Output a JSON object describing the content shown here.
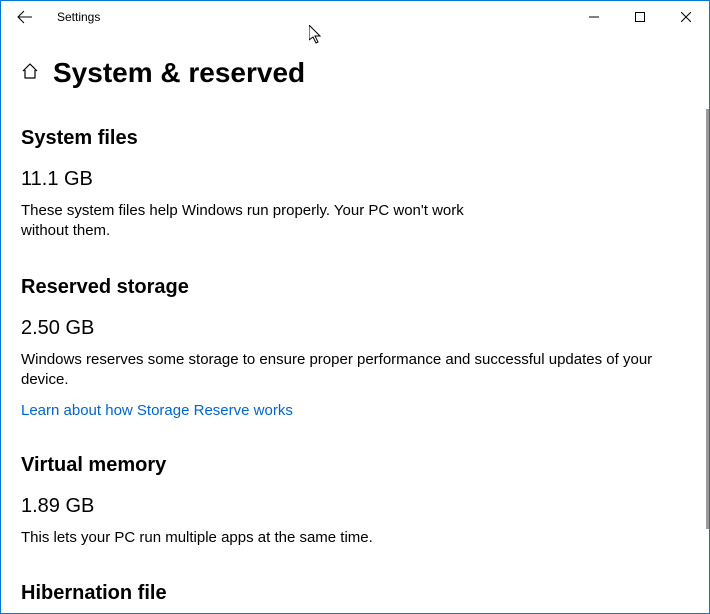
{
  "titlebar": {
    "app_title": "Settings"
  },
  "page": {
    "title": "System & reserved"
  },
  "sections": {
    "system_files": {
      "heading": "System files",
      "value": "11.1 GB",
      "desc": "These system files help Windows run properly. Your PC won't work without them."
    },
    "reserved_storage": {
      "heading": "Reserved storage",
      "value": "2.50 GB",
      "desc": "Windows reserves some storage to ensure proper performance and successful updates of your device.",
      "link": "Learn about how Storage Reserve works"
    },
    "virtual_memory": {
      "heading": "Virtual memory",
      "value": "1.89 GB",
      "desc": "This lets your PC run multiple apps at the same time."
    },
    "hibernation_file": {
      "heading": "Hibernation file"
    }
  }
}
